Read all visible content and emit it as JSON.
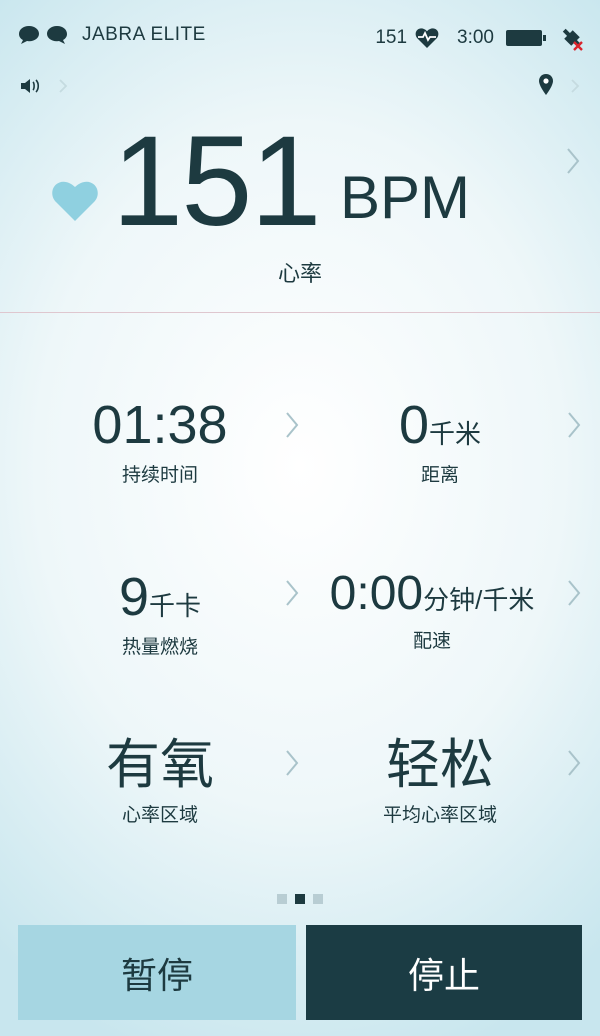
{
  "status": {
    "brand": "JABRA ELITE",
    "heart_rate": "151",
    "time": "3:00"
  },
  "heart_rate": {
    "value": "151",
    "unit": "BPM",
    "label": "心率"
  },
  "metrics": {
    "duration": {
      "value": "01:38",
      "label": "持续时间"
    },
    "distance": {
      "value": "0",
      "unit": "千米",
      "label": "距离"
    },
    "calories": {
      "value": "9",
      "unit": "千卡",
      "label": "热量燃烧"
    },
    "pace": {
      "value": "0:00",
      "unit": "分钟/千米",
      "label": "配速"
    },
    "zone": {
      "value": "有氧",
      "label": "心率区域"
    },
    "avg_zone": {
      "value": "轻松",
      "label": "平均心率区域"
    }
  },
  "pager": {
    "count": 3,
    "active": 1
  },
  "buttons": {
    "pause": "暂停",
    "stop": "停止"
  },
  "colors": {
    "accent": "#a6d6e2",
    "dark": "#1b3c44",
    "heart": "#8fd0e0"
  }
}
